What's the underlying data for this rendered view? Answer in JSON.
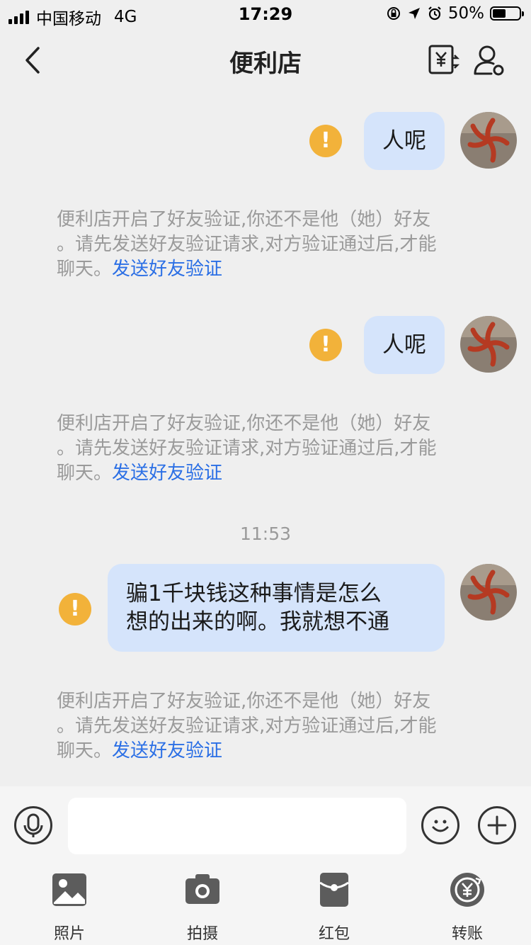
{
  "status_bar": {
    "carrier": "中国移动",
    "network": "4G",
    "time": "17:29",
    "battery_percent": "50%",
    "battery_level": 0.5
  },
  "nav": {
    "title": "便利店",
    "back_icon": "chevron-left-icon",
    "transfer_icon": "yuan-transfer-icon",
    "profile_icon": "person-settings-icon"
  },
  "messages": [
    {
      "text": "人呢",
      "status_icon": "warning-icon",
      "status_symbol": "!"
    },
    {
      "text": "人呢",
      "status_icon": "warning-icon",
      "status_symbol": "!"
    },
    {
      "text_lines": [
        "骗1千块钱这种事情是怎么",
        "想的出来的啊。我就想不通"
      ],
      "status_icon": "warning-icon",
      "status_symbol": "!"
    }
  ],
  "system_notice": {
    "line1": "便利店开启了好友验证,你还不是他（她）好友",
    "line2": "。请先发送好友验证请求,对方验证通过后,才能",
    "line3_prefix": "聊天。",
    "link": "发送好友验证"
  },
  "time_divider": "11:53",
  "input": {
    "placeholder": "",
    "voice_icon": "microphone-icon",
    "emoji_icon": "smiley-icon",
    "plus_icon": "plus-icon"
  },
  "tools": [
    {
      "label": "照片",
      "icon": "photo-icon"
    },
    {
      "label": "拍摄",
      "icon": "camera-icon"
    },
    {
      "label": "红包",
      "icon": "red-packet-icon"
    },
    {
      "label": "转账",
      "icon": "transfer-icon"
    }
  ],
  "colors": {
    "bubble": "#d5e4fb",
    "warning": "#f2b23a",
    "link": "#2b6fe5",
    "background": "#efefef"
  }
}
